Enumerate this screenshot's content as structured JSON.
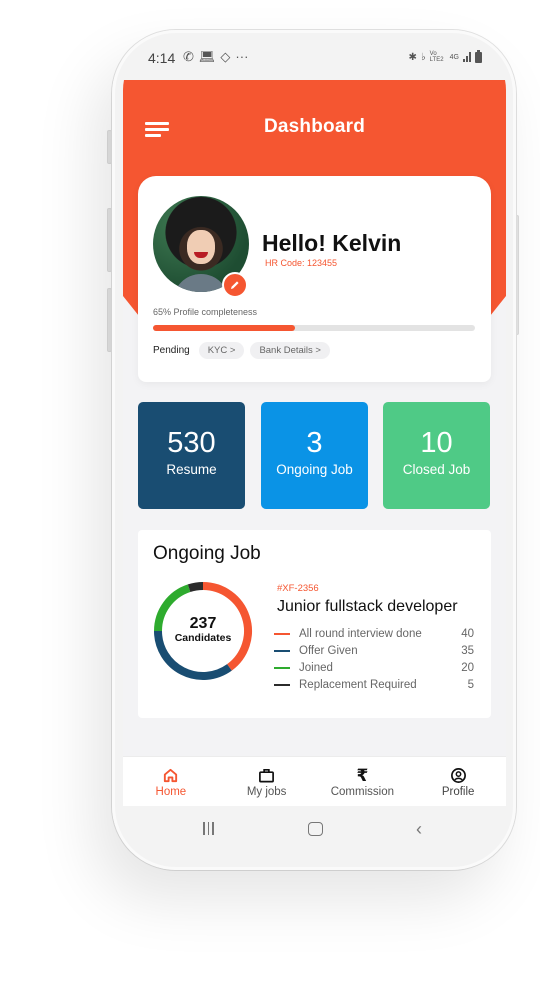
{
  "status_bar": {
    "time": "4:14",
    "left_icons": [
      "whatsapp-icon",
      "laptop-icon",
      "satellite-icon",
      "more-dots-icon"
    ],
    "right_icons": [
      "bluetooth-icon",
      "mute-icon",
      "volte-icon",
      "4g-icon",
      "signal-icon",
      "battery-icon"
    ],
    "volte_label": "Vo LTE2",
    "network_label": "4G"
  },
  "header": {
    "title": "Dashboard",
    "accent_color": "#f55631"
  },
  "profile": {
    "greeting": "Hello! Kelvin",
    "hr_code": "HR Code: 123455",
    "completeness_label": "65% Profile completeness",
    "completeness_percent": 44,
    "pending_label": "Pending",
    "pending_items": [
      {
        "label": "KYC >"
      },
      {
        "label": "Bank Details >"
      }
    ]
  },
  "stats": [
    {
      "value": "530",
      "label": "Resume",
      "color": "#194d72"
    },
    {
      "value": "3",
      "label": "Ongoing Job",
      "color": "#0a93e6"
    },
    {
      "value": "10",
      "label": "Closed Job",
      "color": "#4fca86"
    }
  ],
  "ongoing_job": {
    "section_title": "Ongoing Job",
    "job_code": "#XF-2356",
    "job_title": "Junior fullstack developer",
    "total": "237",
    "total_label": "Candidates",
    "breakdown": [
      {
        "label": "All round interview done",
        "value": 40,
        "color": "#f55631"
      },
      {
        "label": "Offer Given",
        "value": 35,
        "color": "#194d72"
      },
      {
        "label": "Joined",
        "value": 20,
        "color": "#2eab2e"
      },
      {
        "label": "Replacement Required",
        "value": 5,
        "color": "#2b2b2b"
      }
    ]
  },
  "bottom_nav": [
    {
      "label": "Home",
      "icon": "home-icon",
      "active": true
    },
    {
      "label": "My jobs",
      "icon": "briefcase-icon",
      "active": false
    },
    {
      "label": "Commission",
      "icon": "rupee-icon",
      "active": false
    },
    {
      "label": "Profile",
      "icon": "user-circle-icon",
      "active": false
    }
  ],
  "system_nav": [
    "recents-button",
    "home-button",
    "back-button"
  ]
}
